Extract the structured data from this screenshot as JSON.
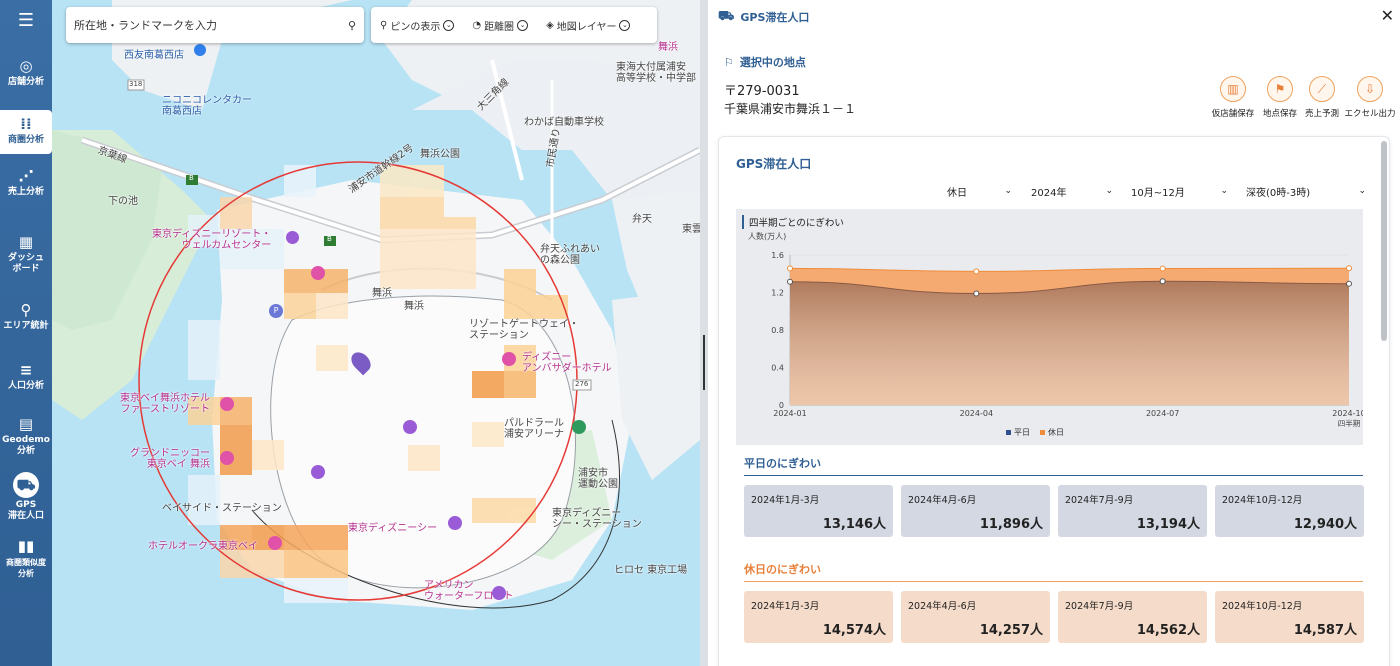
{
  "sidebar": {
    "menu_icon": "hamburger-icon",
    "items": [
      {
        "label": "店舗分析",
        "icon": "store-analysis-icon"
      },
      {
        "label": "商圏分析",
        "icon": "trade-area-icon"
      },
      {
        "label": "売上分析",
        "icon": "sales-analysis-icon"
      },
      {
        "label": "ダッシュ\nボード",
        "icon": "dashboard-icon"
      },
      {
        "label": "エリア統計",
        "icon": "area-stats-icon"
      },
      {
        "label": "人口分析",
        "icon": "population-icon"
      },
      {
        "label": "Geodemo\n分析",
        "icon": "geodemo-icon"
      },
      {
        "label": "GPS\n滞在人口",
        "icon": "gps-icon"
      },
      {
        "label": "商圏類似度\n分析",
        "icon": "similarity-chart-icon"
      }
    ]
  },
  "map": {
    "search_placeholder": "所在地・ランドマークを入力",
    "controls": {
      "pins": "ピンの表示",
      "distance": "距離圏",
      "layers": "地図レイヤー"
    },
    "labels": {
      "nishiyasu": "西友南葛西店",
      "nikoniko": "ニコニコレンタカー\n南葛西店",
      "keiyo": "京葉線",
      "shimonoike": "下の池",
      "maihamakoen": "舞浜公園",
      "urayasu_road": "浦安市道幹線2号",
      "oomitsu": "大三角線",
      "tokai_high": "東海大付属浦安\n高等学校・中学部",
      "wakaba": "わかば自動車学校",
      "shimin_road": "市民通り",
      "benten": "弁天",
      "benten_fureai": "弁天ふれあい\nの森公園",
      "tdr_monument": "東京ディズニーリゾート・\nウェルカムセンター",
      "maihama": "舞浜",
      "maihama_sta": "舞浜",
      "resort_gateway": "リゾートゲートウェイ・\nステーション",
      "ambassador": "ディズニー\nアンバサダーホテル",
      "tokyo_bay_maihama": "東京ベイ舞浜ホテル\nファーストリゾート",
      "grand_nikko": "グランドニッコー\n東京ベイ 舞浜",
      "baseside": "ベイサイド・ステーション",
      "hotel_okura": "ホテルオークラ東京ベイ",
      "tokyo_disneysea": "東京ディズニーシー",
      "parudora": "パルドラール\n浦安アリーナ",
      "urayasu_park": "浦安市\n運動公園",
      "disneysea_station": "東京ディズニー\nシー・ステーション",
      "hirose": "ヒロセ 東京工場",
      "american_waterfront": "アメリカン\nウォーターフロント",
      "maihama_top": "舞浜",
      "toto": "東雲"
    },
    "route_badges": {
      "r318": "318",
      "r276": "276",
      "b": "B"
    }
  },
  "panel": {
    "title": "GPS滞在人口",
    "close": "✕",
    "selected_label": "選択中の地点",
    "postal": "〒279-0031",
    "address": "千葉県浦安市舞浜１－１",
    "actions": [
      {
        "label": "仮店舗保存",
        "icon": "store-save-icon"
      },
      {
        "label": "地点保存",
        "icon": "flag-save-icon"
      },
      {
        "label": "売上予測",
        "icon": "chart-trend-icon"
      },
      {
        "label": "エクセル出力",
        "icon": "excel-export-icon"
      }
    ],
    "card_title": "GPS滞在人口",
    "selects": {
      "day": "休日",
      "year": "2024年",
      "period": "10月~12月",
      "time": "深夜(0時-3時)"
    },
    "chart_title": "四半期ごとのにぎわい",
    "chart_unit": "人数(万人)",
    "weekday_title": "平日のにぎわい",
    "holiday_title": "休日のにぎわい",
    "weekday_stats": [
      {
        "period": "2024年1月-3月",
        "value": "13,146人"
      },
      {
        "period": "2024年4月-6月",
        "value": "11,896人"
      },
      {
        "period": "2024年7月-9月",
        "value": "13,194人"
      },
      {
        "period": "2024年10月-12月",
        "value": "12,940人"
      }
    ],
    "holiday_stats": [
      {
        "period": "2024年1月-3月",
        "value": "14,574人"
      },
      {
        "period": "2024年4月-6月",
        "value": "14,257人"
      },
      {
        "period": "2024年7月-9月",
        "value": "14,562人"
      },
      {
        "period": "2024年10月-12月",
        "value": "14,587人"
      }
    ]
  },
  "chart_data": {
    "type": "area",
    "title": "四半期ごとのにぎわい",
    "ylabel": "人数(万人)",
    "xlabel": "四半期",
    "x": [
      "2024-01",
      "2024-04",
      "2024-07",
      "2024-10"
    ],
    "ylim": [
      0,
      1.6
    ],
    "yticks": [
      "0",
      "0.4",
      "0.8",
      "1.2",
      "1.6"
    ],
    "series": [
      {
        "name": "平日",
        "values": [
          1.3146,
          1.1896,
          1.3194,
          1.294
        ],
        "color": "#2f4f8f",
        "fill": "#b07a5c"
      },
      {
        "name": "休日",
        "values": [
          1.4574,
          1.4257,
          1.4562,
          1.4587
        ],
        "color": "#f08c3a",
        "fill": "#f5a66a"
      }
    ],
    "legend": "bottom"
  },
  "colors": {
    "sidebar": "#2f5f93",
    "accent": "#f08c3a",
    "weekday_card": "#d3d8e3",
    "holiday_card": "#f5dbc9"
  }
}
